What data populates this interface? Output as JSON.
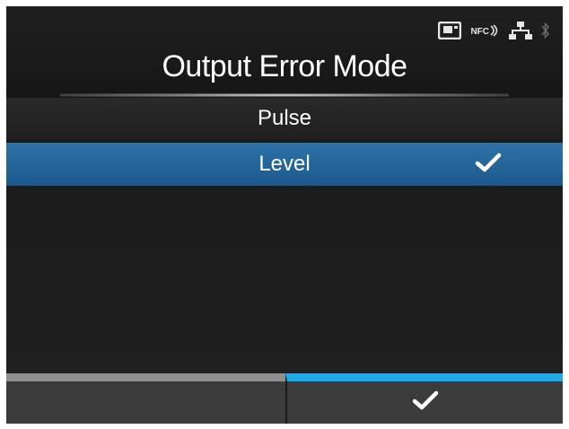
{
  "status_bar": {
    "icons": [
      "sd-card-icon",
      "nfc-icon",
      "network-icon",
      "bluetooth-icon"
    ],
    "nfc_label": "NFC"
  },
  "page": {
    "title": "Output Error Mode"
  },
  "options": [
    {
      "label": "Pulse",
      "selected": false
    },
    {
      "label": "Level",
      "selected": true
    }
  ],
  "footer": {
    "left_button": {
      "label": "",
      "accent_color": "#8f8f8f"
    },
    "right_button": {
      "icon": "check-icon",
      "accent_color": "#1fa9e8"
    }
  },
  "colors": {
    "background": "#1b1b1b",
    "selected_row": "#1d5a8c",
    "accent": "#1fa9e8"
  }
}
